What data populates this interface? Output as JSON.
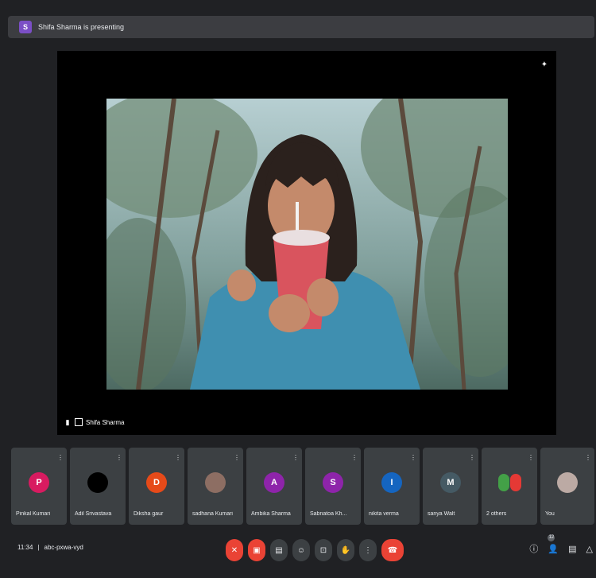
{
  "banner": {
    "avatar_initial": "S",
    "text": "Shifa Sharma is presenting"
  },
  "stage": {
    "presenter_name": "Shifa Sharma"
  },
  "participants": [
    {
      "name": "Pinkal Kumari",
      "initial": "P",
      "color": "#d81b60"
    },
    {
      "name": "Adil Srivastava",
      "initial": "",
      "color": "#000000"
    },
    {
      "name": "Diksha gaur",
      "initial": "D",
      "color": "#e64a19"
    },
    {
      "name": "sadhana Kumari",
      "initial": "",
      "color": "#8d6e63"
    },
    {
      "name": "Ambika Sharma",
      "initial": "A",
      "color": "#8e24aa"
    },
    {
      "name": "Sabnatoa Kh...",
      "initial": "S",
      "color": "#8e24aa"
    },
    {
      "name": "nikita verma",
      "initial": "I",
      "color": "#1565c0"
    },
    {
      "name": "sanya Walt",
      "initial": "M",
      "color": "#455a64"
    },
    {
      "name": "2 others",
      "initial": "",
      "color": "#43a047"
    },
    {
      "name": "You",
      "initial": "",
      "color": "#bcaaa4"
    }
  ],
  "meeting": {
    "time": "11:34",
    "separator": "|",
    "code": "abc-pxwa-vyd"
  },
  "controls": [
    {
      "name": "mic-off-button",
      "icon": "mic-off-icon",
      "glyph": "✕",
      "style": "red"
    },
    {
      "name": "camera-off-button",
      "icon": "camera-off-icon",
      "glyph": "▣",
      "style": "red"
    },
    {
      "name": "captions-button",
      "icon": "captions-icon",
      "glyph": "▤",
      "style": "normal"
    },
    {
      "name": "emoji-button",
      "icon": "emoji-icon",
      "glyph": "☺",
      "style": "normal"
    },
    {
      "name": "present-button",
      "icon": "present-icon",
      "glyph": "⊡",
      "style": "normal"
    },
    {
      "name": "raise-hand-button",
      "icon": "hand-icon",
      "glyph": "✋",
      "style": "normal"
    },
    {
      "name": "more-options-button",
      "icon": "more-vert-icon",
      "glyph": "⋮",
      "style": "normal"
    },
    {
      "name": "leave-call-button",
      "icon": "phone-hangup-icon",
      "glyph": "☎",
      "style": "hangup"
    }
  ],
  "right_controls": {
    "info_glyph": "ⓘ",
    "people_glyph": "👤",
    "people_count": "12",
    "chat_glyph": "▤",
    "activities_glyph": "△"
  }
}
